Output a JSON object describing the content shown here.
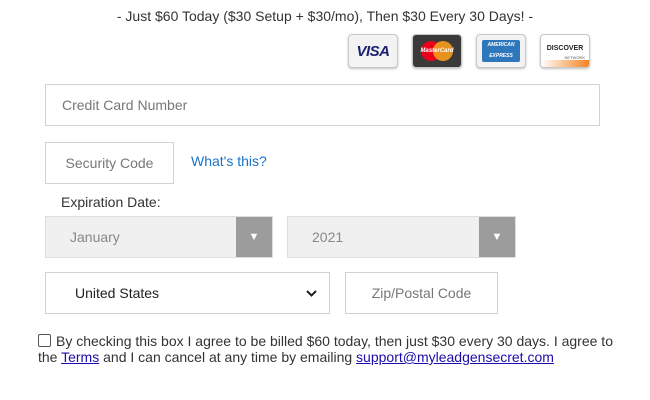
{
  "headline": "- Just $60 Today ($30 Setup + $30/mo), Then $30 Every 30 Days! -",
  "cards": {
    "visa": "VISA",
    "mastercard": "MasterCard",
    "amex": "AMERICAN EXPRESS",
    "discover": "DISCOVER",
    "discover_sub": "NETWORK"
  },
  "form": {
    "card_number_placeholder": "Credit Card Number",
    "security_code_placeholder": "Security Code",
    "whats_this": "What's this?",
    "expiration_label": "Expiration Date:",
    "month_value": "January",
    "year_value": "2021",
    "country_value": "United States",
    "zip_placeholder": "Zip/Postal Code"
  },
  "agreement": {
    "text_before_terms": "By checking this box I agree to be billed $60 today, then just $30 every 30 days. I agree to the ",
    "terms_link": "Terms",
    "text_after_terms": " and I can cancel at any time by emailing ",
    "email_link": "support@myleadgensecret.com"
  },
  "icons": {
    "dropdown_arrow": "▼",
    "chevron": "⌄"
  }
}
